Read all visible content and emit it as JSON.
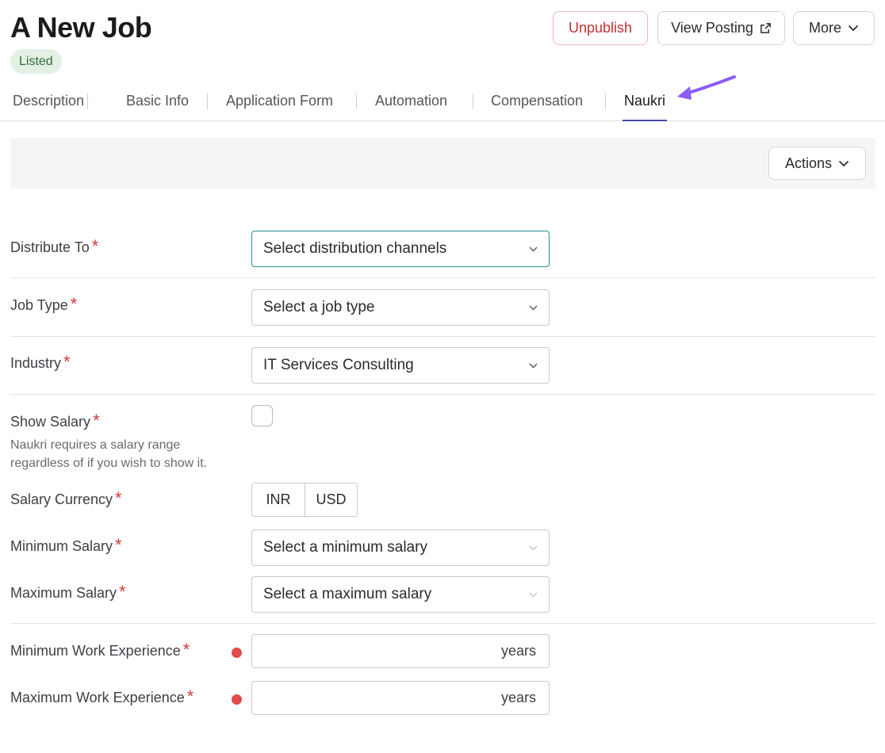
{
  "header": {
    "title": "A New Job",
    "status": "Listed",
    "unpublish_label": "Unpublish",
    "view_posting_label": "View Posting",
    "more_label": "More"
  },
  "tabs": [
    {
      "label": "Description"
    },
    {
      "label": "Basic Info"
    },
    {
      "label": "Application Form"
    },
    {
      "label": "Automation"
    },
    {
      "label": "Compensation"
    },
    {
      "label": "Naukri",
      "active": true
    }
  ],
  "actions": {
    "label": "Actions"
  },
  "form": {
    "distribute_to": {
      "label": "Distribute To",
      "value": "Select distribution channels"
    },
    "job_type": {
      "label": "Job Type",
      "value": "Select a job type"
    },
    "industry": {
      "label": "Industry",
      "value": "IT Services Consulting"
    },
    "show_salary": {
      "label": "Show Salary",
      "helper_line1": "Naukri requires a salary range",
      "helper_line2": "regardless of if you wish to show it.",
      "checked": false
    },
    "salary_currency": {
      "label": "Salary Currency",
      "options": [
        "INR",
        "USD"
      ]
    },
    "min_salary": {
      "label": "Minimum Salary",
      "value": "Select a minimum salary"
    },
    "max_salary": {
      "label": "Maximum Salary",
      "value": "Select a maximum salary"
    },
    "min_experience": {
      "label": "Minimum Work Experience",
      "unit": "years"
    },
    "max_experience": {
      "label": "Maximum Work Experience",
      "unit": "years"
    }
  },
  "required_mark": "*",
  "colors": {
    "accent_tab": "#4a46a8",
    "annotation_arrow": "#8b5cf6",
    "required": "#d33a3a",
    "unpublish": "#c53030",
    "focus_border": "#2a8f9c",
    "badge_bg": "#e2f1e3"
  }
}
